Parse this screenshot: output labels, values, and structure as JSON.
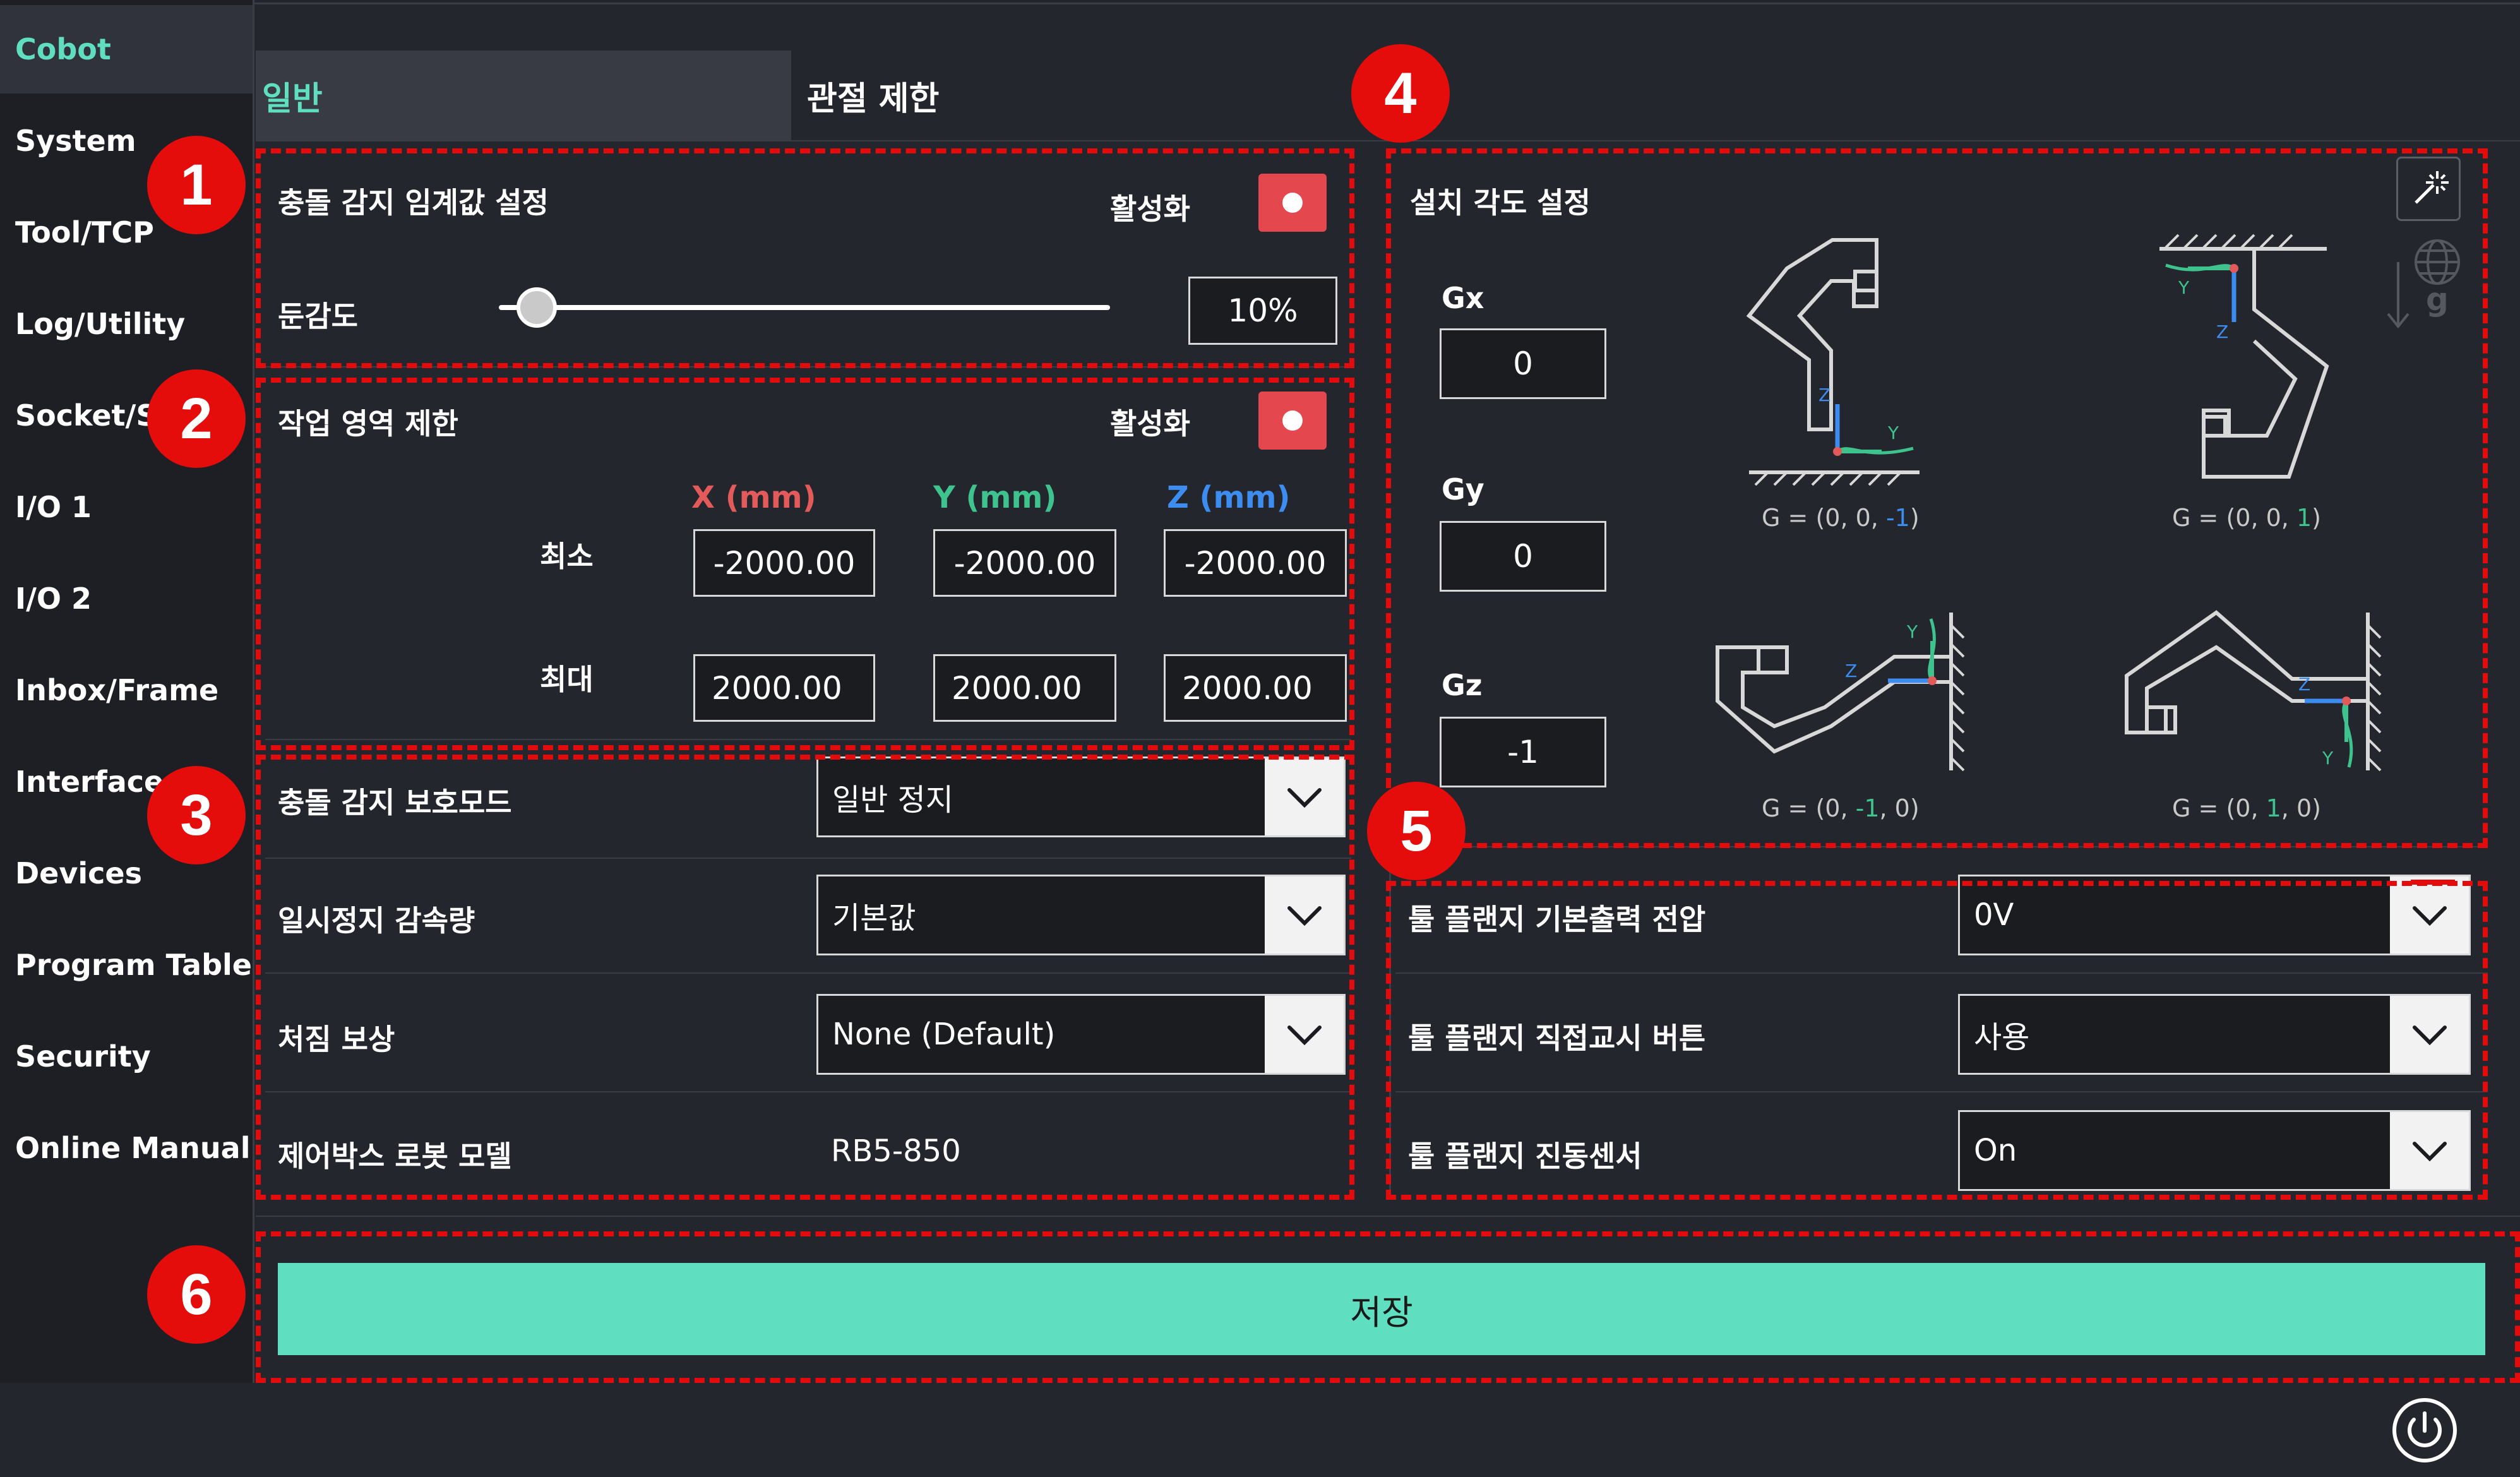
{
  "sidebar": {
    "items": [
      {
        "label": "Cobot",
        "active": true
      },
      {
        "label": "System"
      },
      {
        "label": "Tool/TCP"
      },
      {
        "label": "Log/Utility"
      },
      {
        "label": "Socket/S"
      },
      {
        "label": "I/O 1"
      },
      {
        "label": "I/O 2"
      },
      {
        "label": "Inbox/Frame"
      },
      {
        "label": "Interface"
      },
      {
        "label": "Devices"
      },
      {
        "label": "Program Table"
      },
      {
        "label": "Security"
      },
      {
        "label": "Online Manual"
      }
    ]
  },
  "tabs": [
    {
      "label": "일반",
      "active": true
    },
    {
      "label": "관절 제한",
      "active": false
    }
  ],
  "collision_threshold": {
    "title": "충돌 감지 임계값 설정",
    "enable_label": "활성화",
    "enabled": true,
    "sensitivity_label": "둔감도",
    "sensitivity_value": "10%",
    "slider_fraction": 0.1
  },
  "workspace_limit": {
    "title": "작업 영역 제한",
    "enable_label": "활성화",
    "enabled": true,
    "x_header": "X (mm)",
    "y_header": "Y (mm)",
    "z_header": "Z (mm)",
    "min_label": "최소",
    "max_label": "최대",
    "min": {
      "x": "-2000.00",
      "y": "-2000.00",
      "z": "-2000.00"
    },
    "max": {
      "x": "2000.00",
      "y": "2000.00",
      "z": "2000.00"
    }
  },
  "settings": {
    "protect_mode": {
      "label": "충돌 감지 보호모드",
      "value": "일반 정지"
    },
    "pause_decel": {
      "label": "일시정지 감속량",
      "value": "기본값"
    },
    "sag_comp": {
      "label": "처짐 보상",
      "value": "None (Default)"
    },
    "robot_model": {
      "label": "제어박스 로봇 모델",
      "value": "RB5-850"
    }
  },
  "mount_angle": {
    "title": "설치 각도 설정",
    "gx_label": "Gx",
    "gx": "0",
    "gy_label": "Gy",
    "gy": "0",
    "gz_label": "Gz",
    "gz": "-1",
    "captions": {
      "floor": {
        "pre": "G = (0, 0, ",
        "num": "-1",
        "post": ")"
      },
      "ceiling": {
        "pre": "G = (0, 0, ",
        "num": "1",
        "post": ")"
      },
      "wall_left": {
        "pre": "G = (0, ",
        "num": "-1",
        "post": ", 0)"
      },
      "wall_right": {
        "pre": "G = (0, ",
        "num": "1",
        "post": ", 0)"
      }
    },
    "gravity_label": "g",
    "axis_letters": {
      "x": "X",
      "y": "Y",
      "z": "Z"
    }
  },
  "tool_flange": {
    "voltage": {
      "label": "툴 플랜지 기본출력 전압",
      "value": "0V"
    },
    "direct_teach": {
      "label": "툴 플랜지 직접교시 버튼",
      "value": "사용"
    },
    "vibration": {
      "label": "툴 플랜지 진동센서",
      "value": "On"
    }
  },
  "save_label": "저장",
  "callouts": [
    "1",
    "2",
    "3",
    "4",
    "5",
    "6"
  ],
  "colors": {
    "accent": "#5fdec0",
    "toggle_on": "#e5474f",
    "callout": "#e50c0c",
    "x_axis": "#e35a5a",
    "y_axis": "#3ec28e",
    "z_axis": "#3d8cf0"
  }
}
